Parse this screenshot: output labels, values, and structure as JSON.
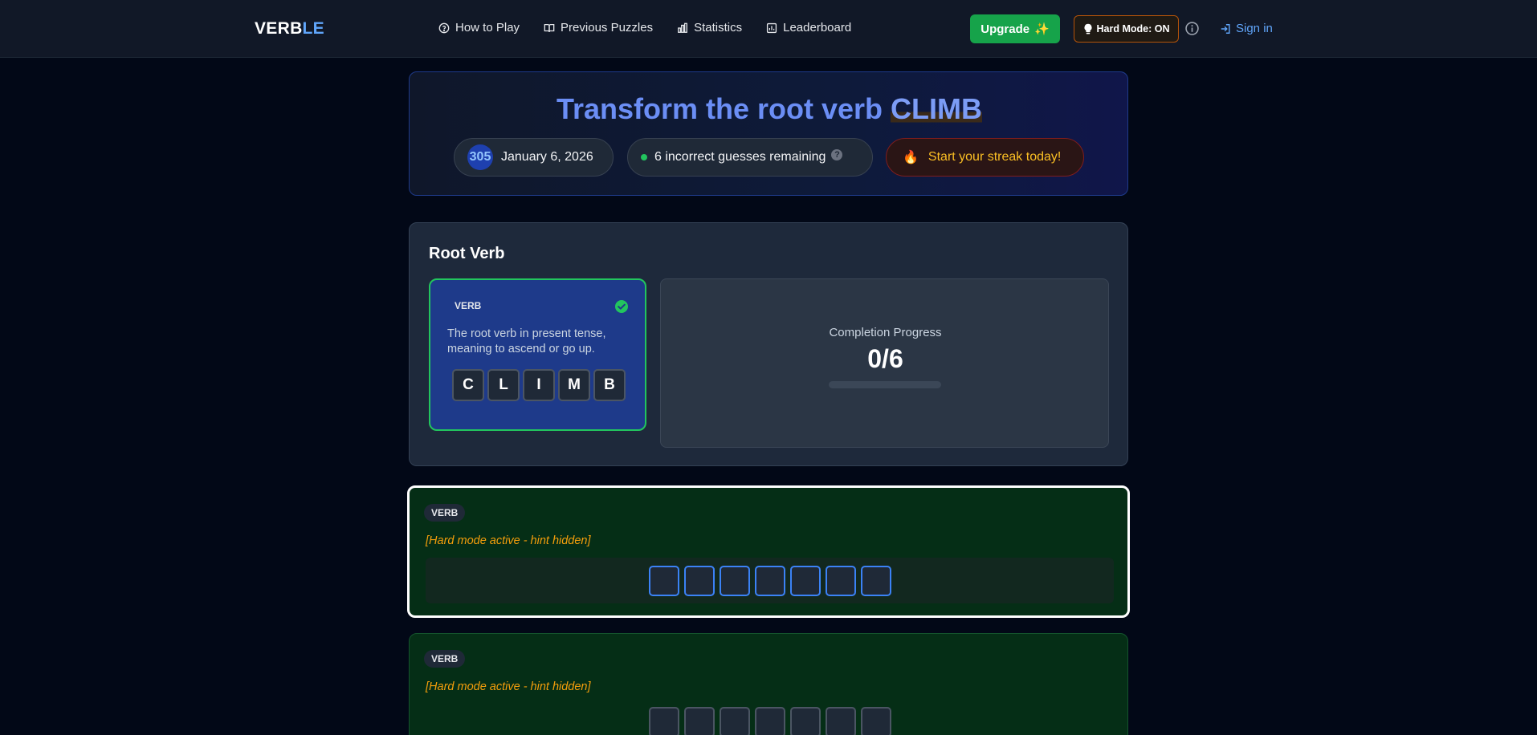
{
  "header": {
    "logo_main": "VERB",
    "logo_accent": "LE",
    "nav": [
      {
        "label": "How to Play",
        "icon": "help-circle-icon"
      },
      {
        "label": "Previous Puzzles",
        "icon": "book-icon"
      },
      {
        "label": "Statistics",
        "icon": "bar-chart-icon"
      },
      {
        "label": "Leaderboard",
        "icon": "leaderboard-icon"
      }
    ],
    "upgrade_label": "Upgrade",
    "upgrade_emoji": "✨",
    "hard_mode_label": "Hard Mode: ON",
    "signin_label": "Sign in"
  },
  "puzzle": {
    "title_prefix": "Transform the root verb ",
    "root_word": "CLIMB",
    "number": "305",
    "date": "January 6, 2026",
    "guesses_remaining": "6 incorrect guesses remaining",
    "streak_label": "Start your streak today!",
    "streak_emoji": "🔥"
  },
  "root_section": {
    "heading": "Root Verb",
    "tag": "VERB",
    "description": "The root verb in present tense, meaning to ascend or go up.",
    "letters": [
      "C",
      "L",
      "I",
      "M",
      "B"
    ],
    "progress_label": "Completion Progress",
    "progress_value": "0/6",
    "progress_fraction": 0
  },
  "guess_rows": [
    {
      "tag": "VERB",
      "hint": "[Hard mode active - hint hidden]",
      "slots": 7
    },
    {
      "tag": "VERB",
      "hint": "[Hard mode active - hint hidden]",
      "slots": 7
    }
  ],
  "colors": {
    "accent_blue": "#60a5fa",
    "success_green": "#22c55e",
    "warning_amber": "#f59e0b"
  }
}
